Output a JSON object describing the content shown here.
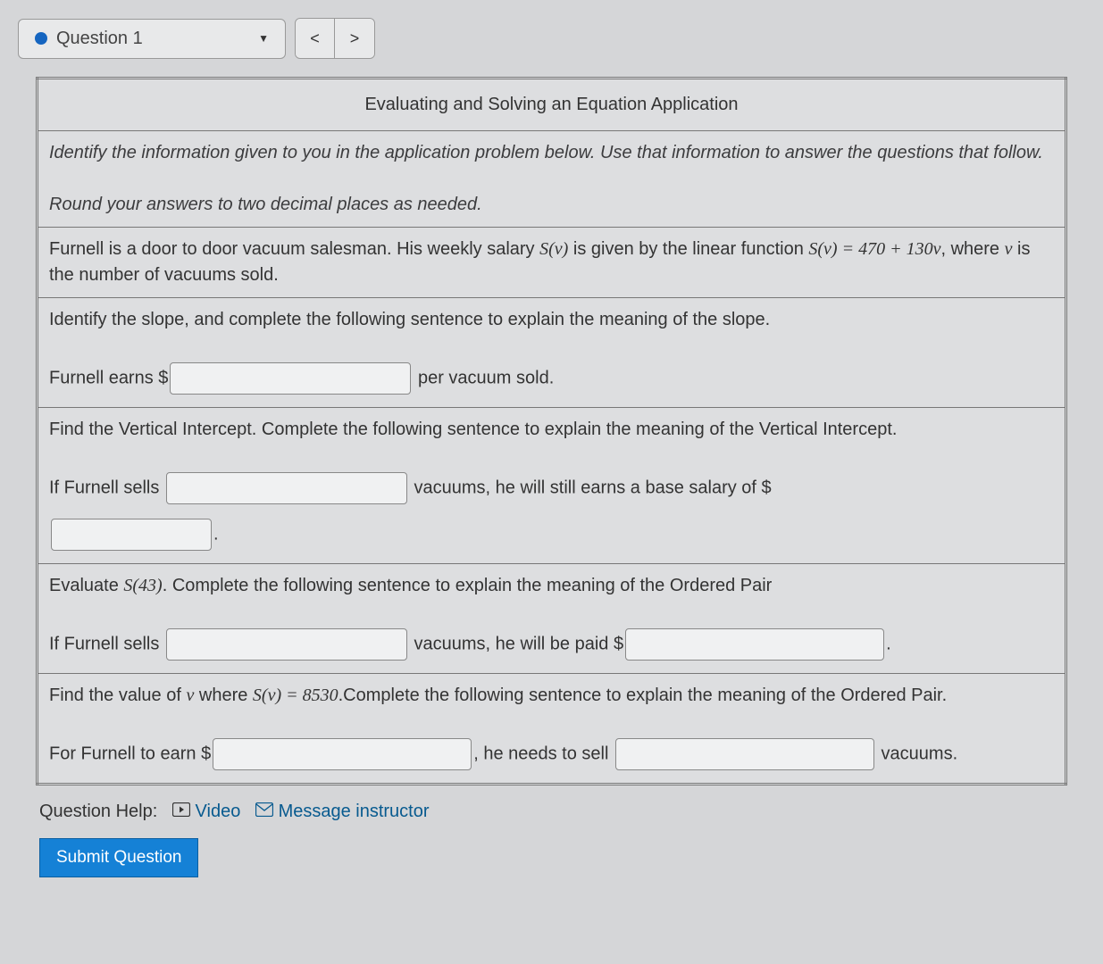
{
  "nav": {
    "question_label": "Question 1",
    "prev": "<",
    "next": ">"
  },
  "table": {
    "title": "Evaluating and Solving an Equation Application",
    "instructions_p1": "Identify the information given to you in the application problem below. Use that information to answer the questions that follow.",
    "instructions_p2": "Round your answers to two decimal places as needed.",
    "scenario_a": "Furnell is a door to door vacuum salesman. His weekly salary ",
    "scenario_b": " is given by the linear function ",
    "scenario_c": ", where ",
    "scenario_d": " is the number of vacuums sold.",
    "sv_label": "S(v)",
    "sv_eq": "S(v) = 470 + 130v",
    "v_label": "v",
    "slope_prompt": "Identify the slope, and complete the following sentence to explain the meaning of the slope.",
    "slope_a": "Furnell earns $",
    "slope_b": " per vacuum sold.",
    "vint_prompt": "Find the Vertical Intercept. Complete the following sentence to explain the meaning of the Vertical Intercept.",
    "vint_a": "If Furnell sells ",
    "vint_b": " vacuums, he will still earns a base salary of $",
    "vint_c": ".",
    "eval_prompt_a": "Evaluate ",
    "eval_sv43": "S(43)",
    "eval_prompt_b": ". Complete the following sentence to explain the meaning of the Ordered Pair",
    "eval_a": "If Furnell sells ",
    "eval_b": " vacuums, he will be paid $",
    "eval_c": ".",
    "solve_prompt_a": "Find the value of ",
    "solve_prompt_b": " where ",
    "solve_eq": "S(v) = 8530",
    "solve_prompt_c": ".Complete the following sentence to explain the meaning of the Ordered Pair.",
    "solve_a": "For Furnell to earn $",
    "solve_b": ", he needs to sell ",
    "solve_c": " vacuums."
  },
  "help": {
    "label": "Question Help:",
    "video": "Video",
    "message": "Message instructor"
  },
  "submit": "Submit Question"
}
